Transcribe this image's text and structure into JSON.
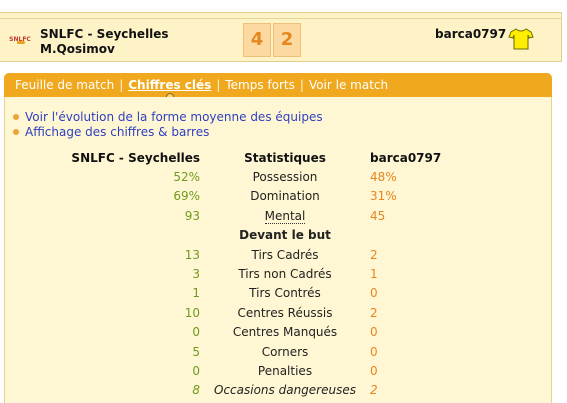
{
  "match": {
    "home_team": "SNLFC - Seychelles",
    "home_coach": "M.Qosimov",
    "home_logo_text": "SNLFC",
    "home_score": "4",
    "away_score": "2",
    "away_team": "barca0797",
    "shirt_icon": "shirt-icon",
    "colors": {
      "score_bg": "#fbd9a0",
      "score_text": "#e6861f",
      "shirt": "#ffee00"
    }
  },
  "tabs": [
    {
      "label": "Feuille de match",
      "active": false
    },
    {
      "label": "Chiffres clés",
      "active": true
    },
    {
      "label": "Temps forts",
      "active": false
    },
    {
      "label": "Voir le match",
      "active": false
    }
  ],
  "links": [
    "Voir l'évolution de la forme moyenne des équipes",
    "Affichage des chiffres & barres"
  ],
  "stats": {
    "header": {
      "home": "SNLFC - Seychelles",
      "label": "Statistiques",
      "away": "barca0797"
    },
    "rows": [
      {
        "home": "52%",
        "label": "Possession",
        "away": "48%"
      },
      {
        "home": "69%",
        "label": "Domination",
        "away": "31%"
      },
      {
        "home": "93",
        "label": "Mental",
        "away": "45"
      }
    ],
    "section": "Devant le but",
    "goal_rows": [
      {
        "home": "13",
        "label": "Tirs Cadrés",
        "away": "2"
      },
      {
        "home": "3",
        "label": "Tirs non Cadrés",
        "away": "1"
      },
      {
        "home": "1",
        "label": "Tirs Contrés",
        "away": "0"
      },
      {
        "home": "10",
        "label": "Centres Réussis",
        "away": "2"
      },
      {
        "home": "0",
        "label": "Centres Manqués",
        "away": "0"
      },
      {
        "home": "5",
        "label": "Corners",
        "away": "0"
      },
      {
        "home": "0",
        "label": "Penalties",
        "away": "0"
      },
      {
        "home": "8",
        "label": "Occasions dangereuses",
        "away": "2"
      }
    ]
  },
  "colors": {
    "tabbar": "#f0a81e",
    "panel_bg": "#fff7d3",
    "home_value": "#6f9a1e",
    "away_value": "#e6861f",
    "link": "#2f3fc0"
  }
}
